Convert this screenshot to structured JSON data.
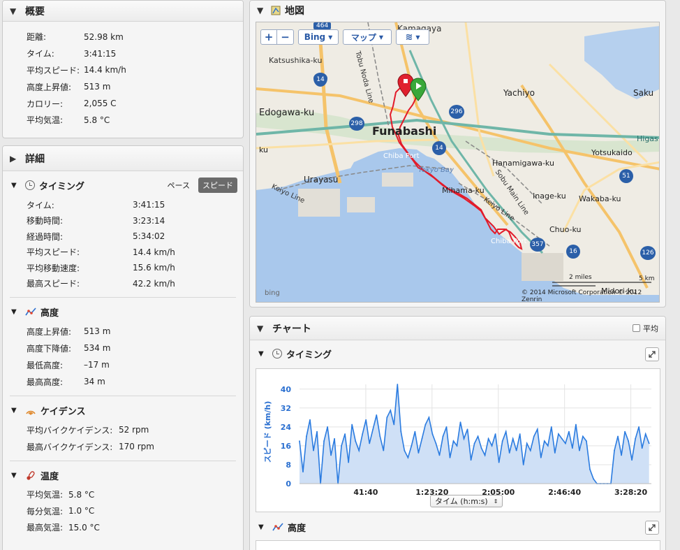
{
  "summary": {
    "title": "概要",
    "rows": [
      {
        "k": "距離:",
        "v": "52.98 km"
      },
      {
        "k": "タイム:",
        "v": "3:41:15"
      },
      {
        "k": "平均スピード:",
        "v": "14.4 km/h"
      },
      {
        "k": "高度上昇値:",
        "v": "513 m"
      },
      {
        "k": "カロリー:",
        "v": "2,055 C"
      },
      {
        "k": "平均気温:",
        "v": "5.8 °C"
      }
    ]
  },
  "details": {
    "title": "詳細",
    "timing": {
      "title": "タイミング",
      "pace_label": "ペース",
      "speed_label": "スピード",
      "rows": [
        {
          "k": "タイム:",
          "v": "3:41:15"
        },
        {
          "k": "移動時間:",
          "v": "3:23:14"
        },
        {
          "k": "経過時間:",
          "v": "5:34:02"
        },
        {
          "k": "平均スピード:",
          "v": "14.4 km/h"
        },
        {
          "k": "平均移動速度:",
          "v": "15.6 km/h"
        },
        {
          "k": "最高スピード:",
          "v": "42.2 km/h"
        }
      ]
    },
    "elevation": {
      "title": "高度",
      "rows": [
        {
          "k": "高度上昇値:",
          "v": "513 m"
        },
        {
          "k": "高度下降値:",
          "v": "534 m"
        },
        {
          "k": "最低高度:",
          "v": "–17 m"
        },
        {
          "k": "最高高度:",
          "v": "34 m"
        }
      ]
    },
    "cadence": {
      "title": "ケイデンス",
      "rows": [
        {
          "k": "平均バイクケイデンス:",
          "v": "52 rpm"
        },
        {
          "k": "最高バイクケイデンス:",
          "v": "170 rpm"
        }
      ]
    },
    "temperature": {
      "title": "温度",
      "rows": [
        {
          "k": "平均気温:",
          "v": "5.8 °C"
        },
        {
          "k": "毎分気温:",
          "v": "1.0 °C"
        },
        {
          "k": "最高気温:",
          "v": "15.0 °C"
        }
      ]
    }
  },
  "map": {
    "title": "地図",
    "zoom_in": "+",
    "zoom_out": "−",
    "provider": "Bing",
    "map_type": "マップ",
    "scale_miles": "2 miles",
    "scale_km": "5 km",
    "copyright": "© 2014 Microsoft Corporation © 2012 Zenrin",
    "bing_logo": "bing",
    "labels": [
      {
        "t": "Kamagaya",
        "size": 12
      },
      {
        "t": "Katsushika-ku",
        "size": 11
      },
      {
        "t": "Yachiyo",
        "size": 12
      },
      {
        "t": "Saku",
        "size": 12
      },
      {
        "t": "Edogawa-ku",
        "size": 13
      },
      {
        "t": "Funabashi",
        "size": 16
      },
      {
        "t": "Higas",
        "size": 11
      },
      {
        "t": "Chiba Port",
        "size": 10
      },
      {
        "t": "Tokyo Bay",
        "size": 10
      },
      {
        "t": "Urayasu",
        "size": 12
      },
      {
        "t": "Hanamigawa-ku",
        "size": 11
      },
      {
        "t": "Yotsukaido",
        "size": 11
      },
      {
        "t": "Mihama-ku",
        "size": 11
      },
      {
        "t": "Inage-ku",
        "size": 11
      },
      {
        "t": "Wakaba-ku",
        "size": 11
      },
      {
        "t": "Chuo-ku",
        "size": 11
      },
      {
        "t": "Chiba Port",
        "size": 10
      },
      {
        "t": "Midori-ku",
        "size": 11
      },
      {
        "t": "Keiyo Line",
        "size": 10
      },
      {
        "t": "Keiyo Line",
        "size": 10
      },
      {
        "t": "Sobu Main Line",
        "size": 10
      },
      {
        "t": "Tobu Noda Line",
        "size": 10
      },
      {
        "t": "ku",
        "size": 11
      }
    ],
    "shields": [
      "464",
      "14",
      "298",
      "296",
      "14",
      "51",
      "357",
      "16",
      "126"
    ]
  },
  "chart": {
    "title": "チャート",
    "avg_label": "平均",
    "timing_title": "タイミング",
    "elevation_title": "高度",
    "axis_select": "タイム (h:m:s)"
  },
  "chart_data": {
    "type": "area",
    "ylabel": "スピード (km/h)",
    "xlabel": "タイム (h:m:s)",
    "ylim": [
      0,
      42
    ],
    "yticks": [
      0,
      8,
      16,
      24,
      32,
      40
    ],
    "xticks": [
      "41:40",
      "1:23:20",
      "2:05:00",
      "2:46:40",
      "3:28:20"
    ],
    "x_minutes": [
      0,
      2.2,
      4.4,
      6.6,
      8.8,
      11,
      13.2,
      15.4,
      17.6,
      19.8,
      22,
      24.2,
      26.4,
      28.6,
      30.8,
      33,
      35.2,
      37.4,
      39.6,
      41.8,
      44,
      46.2,
      48.4,
      50.6,
      52.8,
      55,
      57.2,
      59.4,
      61.6,
      63.8,
      66,
      68.2,
      70.4,
      72.6,
      74.8,
      77,
      79.2,
      81.4,
      83.6,
      85.8,
      88,
      90.2,
      92.4,
      94.6,
      96.8,
      99,
      101.2,
      103.4,
      105.6,
      107.8,
      110,
      112.2,
      114.4,
      116.6,
      118.8,
      121,
      123.2,
      125.4,
      127.6,
      129.8,
      132,
      134.2,
      136.4,
      138.6,
      140.8,
      143,
      145.2,
      147.4,
      149.6,
      151.8,
      154,
      156.2,
      158.4,
      160.6,
      162.8,
      165,
      167.2,
      169.4,
      171.6,
      173.8,
      176,
      178.2,
      180.4,
      182.6,
      184.8,
      187,
      189.2,
      191.4,
      193.6,
      195.8,
      198,
      200.2,
      202.4,
      204.6,
      206.8,
      209,
      211.2,
      213.4,
      215.4,
      217.6,
      219.8
    ],
    "values": [
      18,
      5,
      20,
      27,
      14,
      22,
      0,
      18,
      24,
      12,
      19,
      0,
      16,
      21,
      9,
      25,
      18,
      14,
      21,
      27,
      17,
      23,
      29,
      20,
      14,
      28,
      31,
      25,
      42,
      22,
      14,
      11,
      16,
      22,
      13,
      19,
      25,
      28,
      21,
      17,
      12,
      20,
      24,
      11,
      18,
      16,
      26,
      19,
      23,
      10,
      17,
      20,
      15,
      12,
      19,
      16,
      21,
      9,
      18,
      22,
      13,
      19,
      14,
      21,
      8,
      17,
      14,
      20,
      23,
      11,
      18,
      16,
      24,
      13,
      21,
      19,
      17,
      22,
      15,
      25,
      14,
      20,
      18,
      6,
      2,
      0,
      0,
      0,
      0,
      0,
      14,
      20,
      12,
      22,
      18,
      10,
      19,
      24,
      15,
      21,
      17,
      11
    ],
    "grid": true
  }
}
